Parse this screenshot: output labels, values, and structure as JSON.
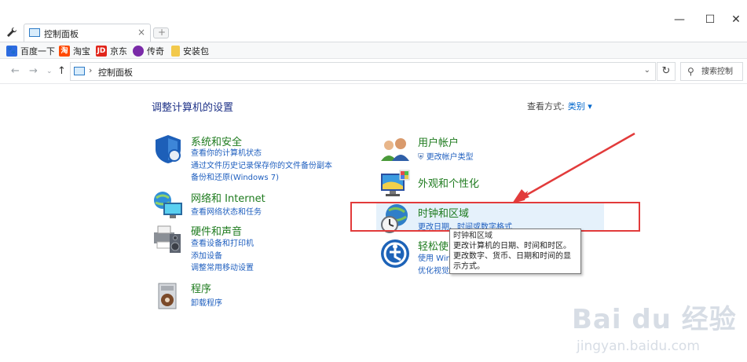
{
  "browser": {
    "tab": {
      "title": "控制面板",
      "close": "×"
    },
    "window_controls": {
      "minimize": "—",
      "maximize": "☐",
      "close": "✕"
    },
    "bookmarks": [
      {
        "label": "百度一下",
        "icon": "baidu-paw-icon",
        "color": "#2d6be0"
      },
      {
        "label": "淘宝",
        "icon": "taobao-icon",
        "color": "#ff4a00"
      },
      {
        "label": "京东",
        "icon": "jd-icon",
        "color": "#e1251b"
      },
      {
        "label": "传奇",
        "icon": "game-icon",
        "color": "#7a2aa8"
      },
      {
        "label": "安装包",
        "icon": "folder-icon",
        "color": "#f2c94c"
      }
    ],
    "address": {
      "separator": "›",
      "path": "控制面板"
    },
    "search": {
      "placeholder": "搜索控制"
    }
  },
  "content": {
    "heading": "调整计算机的设置",
    "view_by_label": "查看方式:",
    "view_by_value": "类别 ▾",
    "left_categories": [
      {
        "title": "系统和安全",
        "icon": "shield-icon",
        "links": [
          "查看你的计算机状态",
          "通过文件历史记录保存你的文件备份副本",
          "备份和还原(Windows 7)"
        ]
      },
      {
        "title": "网络和 Internet",
        "icon": "network-globe-icon",
        "links": [
          "查看网络状态和任务"
        ]
      },
      {
        "title": "硬件和声音",
        "icon": "printer-speaker-icon",
        "links": [
          "查看设备和打印机",
          "添加设备",
          "调整常用移动设置"
        ]
      },
      {
        "title": "程序",
        "icon": "programs-disc-icon",
        "links": [
          "卸载程序"
        ]
      }
    ],
    "right_categories": [
      {
        "title": "用户帐户",
        "icon": "users-icon",
        "links": [
          "更改帐户类型"
        ]
      },
      {
        "title": "外观和个性化",
        "icon": "monitor-palette-icon",
        "links": []
      },
      {
        "title": "时钟和区域",
        "icon": "clock-globe-icon",
        "links": [
          "更改日期、时间或数字格式"
        ]
      },
      {
        "title": "轻松使",
        "icon": "accessibility-icon",
        "links": [
          "使用 Win",
          "优化视觉"
        ]
      }
    ],
    "tooltip": {
      "title": "时钟和区域",
      "body": "更改计算机的日期、时间和时区。更改数字、货币、日期和时间的显示方式。"
    }
  },
  "watermark": {
    "main": "Bai du 经验",
    "sub": "jingyan.baidu.com"
  },
  "colors": {
    "link": "#1f5fbf",
    "category_title": "#1e7b1e",
    "heading": "#1e3287",
    "annotation": "#e23b3b",
    "hover": "#e5f1fb"
  }
}
